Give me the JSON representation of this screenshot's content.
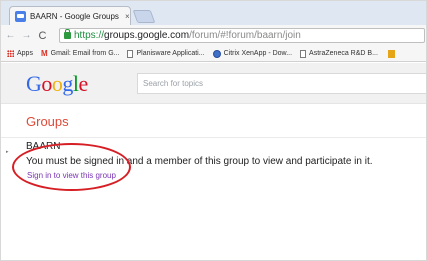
{
  "browser": {
    "tab": {
      "favicon": "google-groups-favicon",
      "title": "BAARN - Google Groups",
      "close_glyph": "×"
    },
    "nav": {
      "back_icon": "back-arrow-icon",
      "back_glyph": "←",
      "forward_icon": "forward-arrow-icon",
      "forward_glyph": "→",
      "reload_icon": "reload-icon",
      "reload_glyph": "C"
    },
    "omnibox": {
      "lock_icon": "lock-icon",
      "scheme": "https://",
      "host": "groups.google.com",
      "path": "/forum/#!forum/baarn/join"
    },
    "bookmarks": [
      {
        "label": "Apps",
        "icon": "apps-grid-icon"
      },
      {
        "label": "Gmail: Email from G...",
        "icon": "gmail-icon"
      },
      {
        "label": "Planisware Applicati...",
        "icon": "page-icon"
      },
      {
        "label": "Citrix XenApp - Dow...",
        "icon": "citrix-icon"
      },
      {
        "label": "AstraZeneca R&D B...",
        "icon": "page-icon"
      }
    ]
  },
  "google_header": {
    "logo_letters": [
      "G",
      "o",
      "o",
      "g",
      "l",
      "e"
    ],
    "search_placeholder": "Search for topics"
  },
  "groups_bar": {
    "title": "Groups"
  },
  "content": {
    "group_name": "BAARN",
    "message": "You must be signed in and a member of this group to view and participate in it.",
    "signin_link": "Sign in to view this group"
  },
  "colors": {
    "tabstrip": "#dfe7f3",
    "groups_title": "#dd4b39",
    "link": "#7b35b5",
    "annotation": "#d61f25"
  }
}
